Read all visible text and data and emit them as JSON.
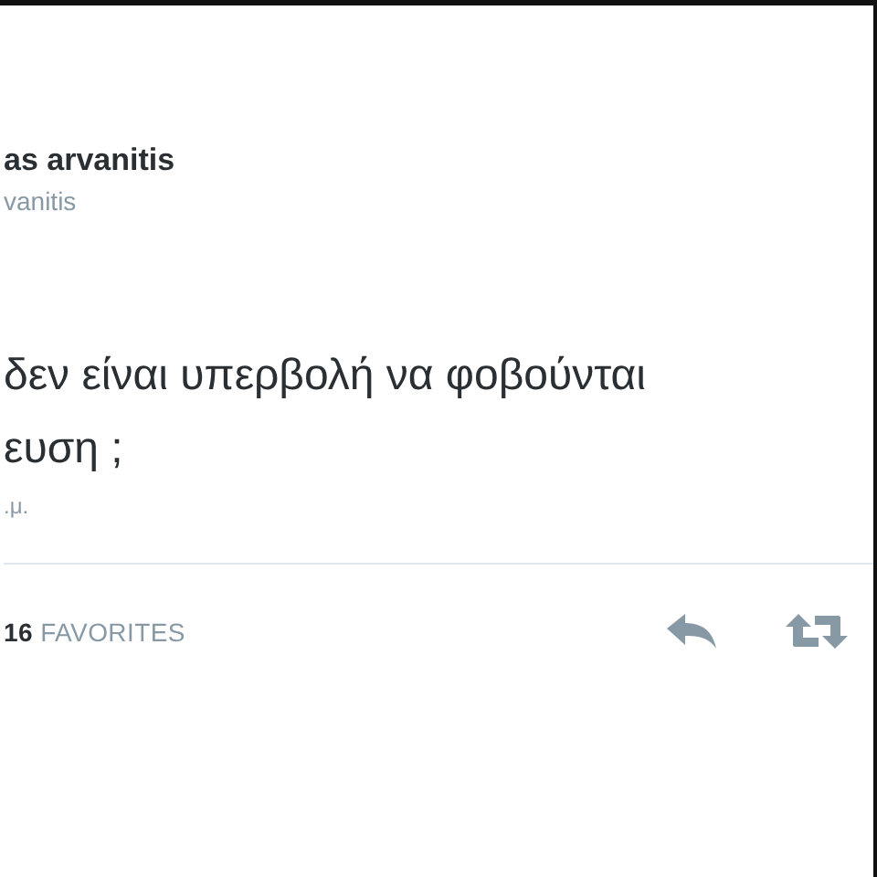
{
  "tweet": {
    "author_name": "as arvanitis",
    "author_handle": "vanitis",
    "text_lines": [
      "δεν είναι υπερβολή να φοβούνται",
      "ευση ;"
    ],
    "timestamp": ".μ.",
    "favorites": {
      "count": "16",
      "label": "FAVORITES"
    }
  }
}
